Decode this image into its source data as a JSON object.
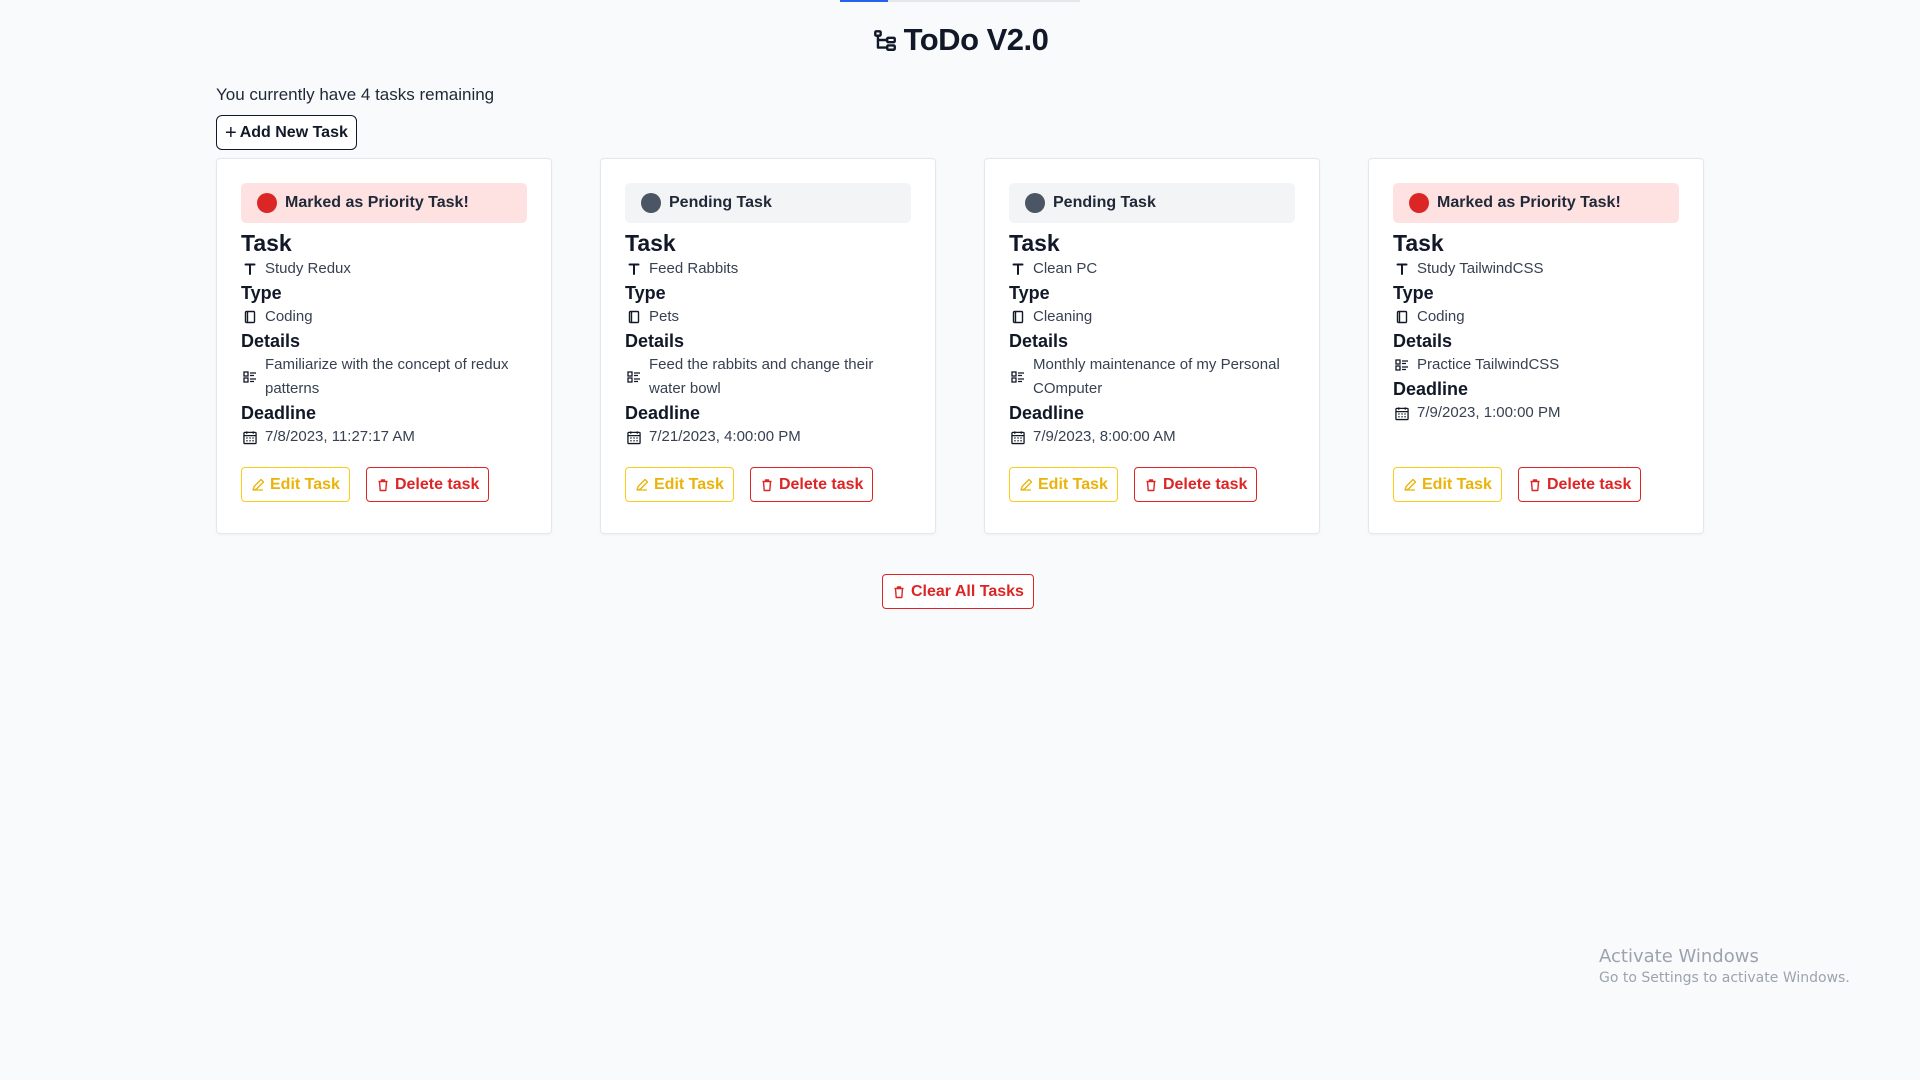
{
  "header": {
    "title": "ToDo V2.0",
    "logo_icon": "hierarchy-icon"
  },
  "summary": {
    "remaining_text": "You currently have 4 tasks remaining"
  },
  "toolbar": {
    "add_plus": "+",
    "add_label": "Add New Task",
    "clear_label": "Clear All Tasks"
  },
  "labels": {
    "task": "Task",
    "type": "Type",
    "details": "Details",
    "deadline": "Deadline",
    "edit": "Edit Task",
    "delete": "Delete task"
  },
  "colors": {
    "priority_bg": "#fee2e2",
    "priority_dot": "#dc2626",
    "pending_bg": "#f3f4f6",
    "pending_dot": "#4b5563",
    "edit_accent": "#eab308",
    "delete_accent": "#dc2626"
  },
  "tasks": [
    {
      "status": "Marked as Priority Task!",
      "status_kind": "priority",
      "name": "Study Redux",
      "type": "Coding",
      "details": "Familiarize with the concept of redux patterns",
      "deadline": "7/8/2023, 11:27:17 AM"
    },
    {
      "status": "Pending Task",
      "status_kind": "pending",
      "name": "Feed Rabbits",
      "type": "Pets",
      "details": "Feed the rabbits and change their water bowl",
      "deadline": "7/21/2023, 4:00:00 PM"
    },
    {
      "status": "Pending Task",
      "status_kind": "pending",
      "name": "Clean PC",
      "type": "Cleaning",
      "details": "Monthly maintenance of my Personal COmputer",
      "deadline": "7/9/2023, 8:00:00 AM"
    },
    {
      "status": "Marked as Priority Task!",
      "status_kind": "priority",
      "name": "Study TailwindCSS",
      "type": "Coding",
      "details": "Practice TailwindCSS",
      "deadline": "7/9/2023, 1:00:00 PM"
    }
  ],
  "watermark": {
    "title": "Activate Windows",
    "subtitle": "Go to Settings to activate Windows."
  }
}
